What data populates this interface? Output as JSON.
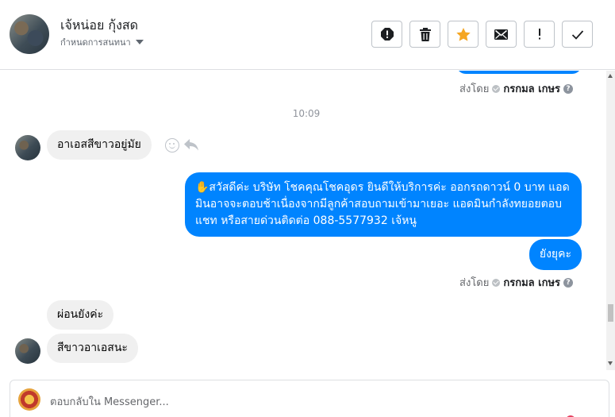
{
  "header": {
    "contact_name": "เจ้หน่อย กุ้งสด",
    "assign_label": "กำหนดการสนทนา",
    "toolbar": [
      "alert-icon",
      "trash-icon",
      "star-icon",
      "envelope-icon",
      "exclamation-icon",
      "checkmark-icon"
    ]
  },
  "thread": {
    "sent_by_prefix": "ส่งโดย",
    "sent_by_name": "กรกมล เกษร",
    "time_divider": "10:09",
    "messages_in_1": "อาเอสสีขาวอยู่มัย",
    "message_out_long": "✋สวัสดีค่ะ บริษัท โชคคุณโชคอุดร ยินดีให้บริการค่ะ ออกรถดาวน์ 0 บาท แอดมินอาจจะตอบช้าเนื่องจากมีลูกค้าสอบถามเข้ามาเยอะ แอดมินกำลังทยอยตอบแชท หรือสายด่วนติดต่อ 088-5577932 เจ้หนู",
    "message_out_short": "ยังยุคะ",
    "messages_in_2": "ผ่อนยังค่ะ",
    "messages_in_3": "สีขาวอาเอสนะ"
  },
  "composer": {
    "placeholder": "ตอบกลับใน Messenger..."
  },
  "colors": {
    "outgoing": "#0084ff",
    "incoming": "#f0f0f0",
    "star": "#f5a623"
  }
}
